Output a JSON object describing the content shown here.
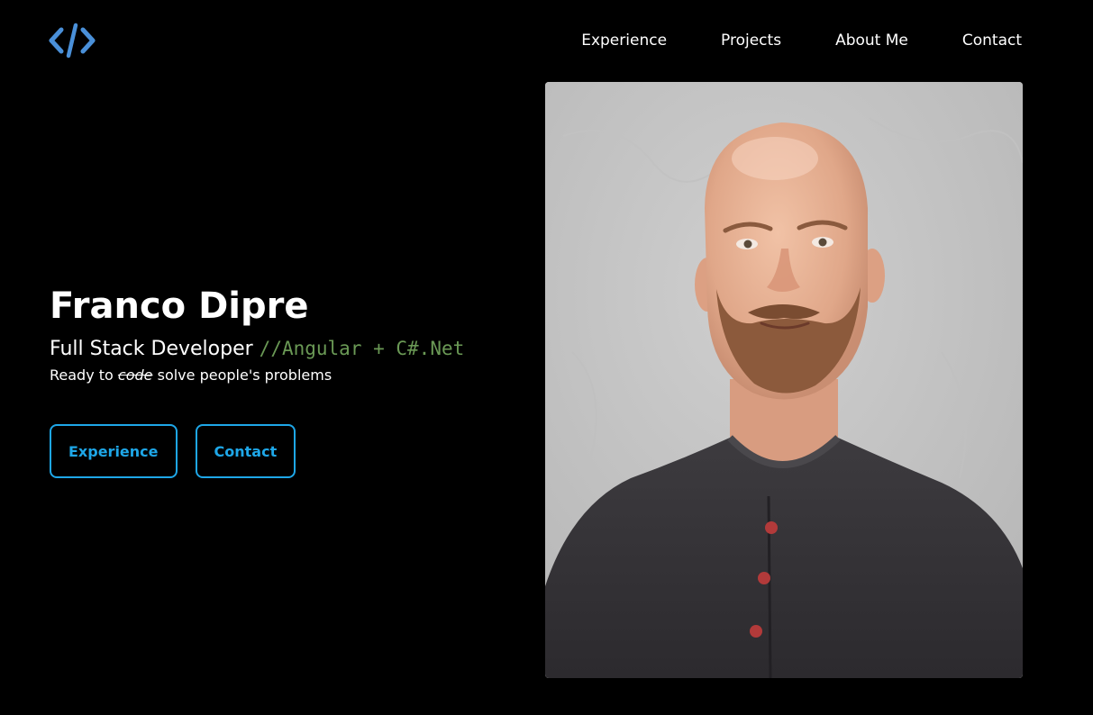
{
  "header": {
    "logo_icon": "code-brackets-icon",
    "accent_color": "#4a90d9",
    "nav": [
      {
        "label": "Experience"
      },
      {
        "label": "Projects"
      },
      {
        "label": "About Me"
      },
      {
        "label": "Contact"
      }
    ]
  },
  "hero": {
    "name": "Franco Dipre",
    "role": "Full Stack Developer",
    "stack": "//Angular + C#.Net",
    "tagline_prefix": "Ready to",
    "tagline_struck": "code",
    "tagline_suffix": "solve people's problems",
    "buttons": [
      {
        "label": "Experience"
      },
      {
        "label": "Contact"
      }
    ]
  },
  "colors": {
    "background": "#000000",
    "button_accent": "#1ea7e8",
    "code_comment": "#6a9955"
  }
}
